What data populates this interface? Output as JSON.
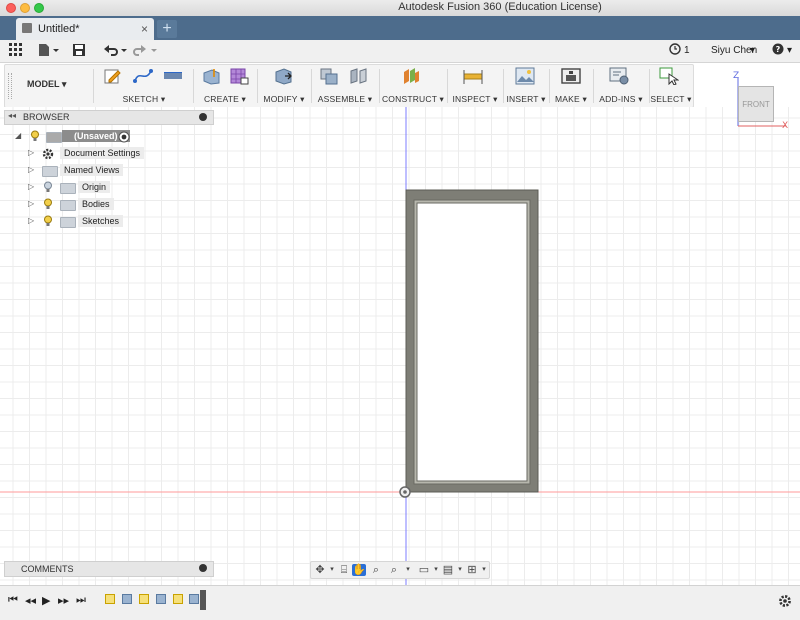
{
  "window": {
    "title": "Autodesk Fusion 360 (Education License)"
  },
  "tabs": [
    {
      "label": "Untitled*"
    }
  ],
  "quickbar": {
    "jobs_count": "1",
    "user_name": "Siyu Chen",
    "help_label": "?"
  },
  "workspace": {
    "label": "MODEL"
  },
  "toolbar": {
    "groups": [
      {
        "label": "SKETCH"
      },
      {
        "label": "CREATE"
      },
      {
        "label": "MODIFY"
      },
      {
        "label": "ASSEMBLE"
      },
      {
        "label": "CONSTRUCT"
      },
      {
        "label": "INSPECT"
      },
      {
        "label": "INSERT"
      },
      {
        "label": "MAKE"
      },
      {
        "label": "ADD-INS"
      },
      {
        "label": "SELECT"
      }
    ]
  },
  "viewcube": {
    "face": "FRONT",
    "axis_z": "Z",
    "axis_x": "X"
  },
  "browser": {
    "title": "BROWSER",
    "root": "(Unsaved)",
    "items": [
      {
        "label": "Document Settings"
      },
      {
        "label": "Named Views"
      },
      {
        "label": "Origin"
      },
      {
        "label": "Bodies"
      },
      {
        "label": "Sketches"
      }
    ]
  },
  "comments": {
    "title": "COMMENTS"
  },
  "colors": {
    "tab_strip": "#4d6c8c",
    "axis_blue": "#7070ff",
    "axis_red": "#ff8a8a",
    "body_fill": "#808078"
  }
}
